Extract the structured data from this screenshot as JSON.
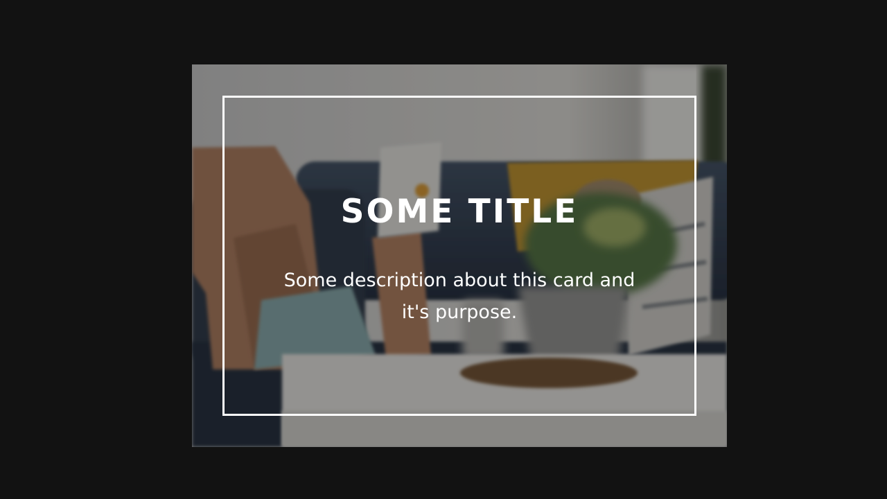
{
  "card": {
    "title": "SOME TITLE",
    "description": "Some description about this card and it's purpose."
  },
  "colors": {
    "page_background": "#121212",
    "frame": "#ffffff",
    "text": "#ffffff"
  }
}
